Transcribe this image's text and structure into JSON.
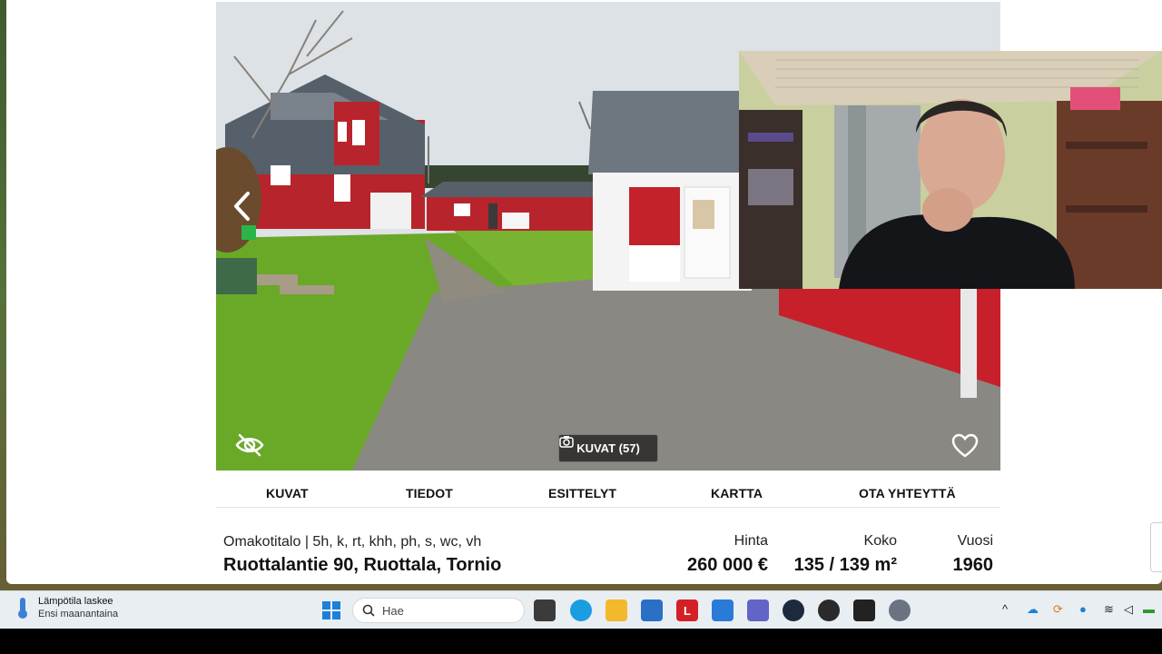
{
  "tabs": [
    "KUVAT",
    "TIEDOT",
    "ESITTELYT",
    "KARTTA",
    "OTA YHTEYTTÄ"
  ],
  "photo": {
    "gallery_button": "KUVAT (57)"
  },
  "listing": {
    "type_line": "Omakotitalo | 5h, k, rt, khh, ph, s, wc, vh",
    "address": "Ruottalantie 90, Ruottala, Tornio",
    "price_label": "Hinta",
    "price_value": "260 000 €",
    "size_label": "Koko",
    "size_value": "135 / 139 m²",
    "year_label": "Vuosi",
    "year_value": "1960"
  },
  "taskbar": {
    "weather_title": "Lämpötila laskee",
    "weather_sub": "Ensi maanantaina",
    "search_placeholder": "Hae",
    "pinned_apps": [
      "windows-start",
      "file-explorer",
      "edge",
      "folder",
      "store",
      "lastpass",
      "mail",
      "teams",
      "steam",
      "app-red",
      "epic-games",
      "settings"
    ]
  },
  "colors": {
    "accent_red": "#c8202a",
    "taskbar_bg": "#e9eef3"
  }
}
